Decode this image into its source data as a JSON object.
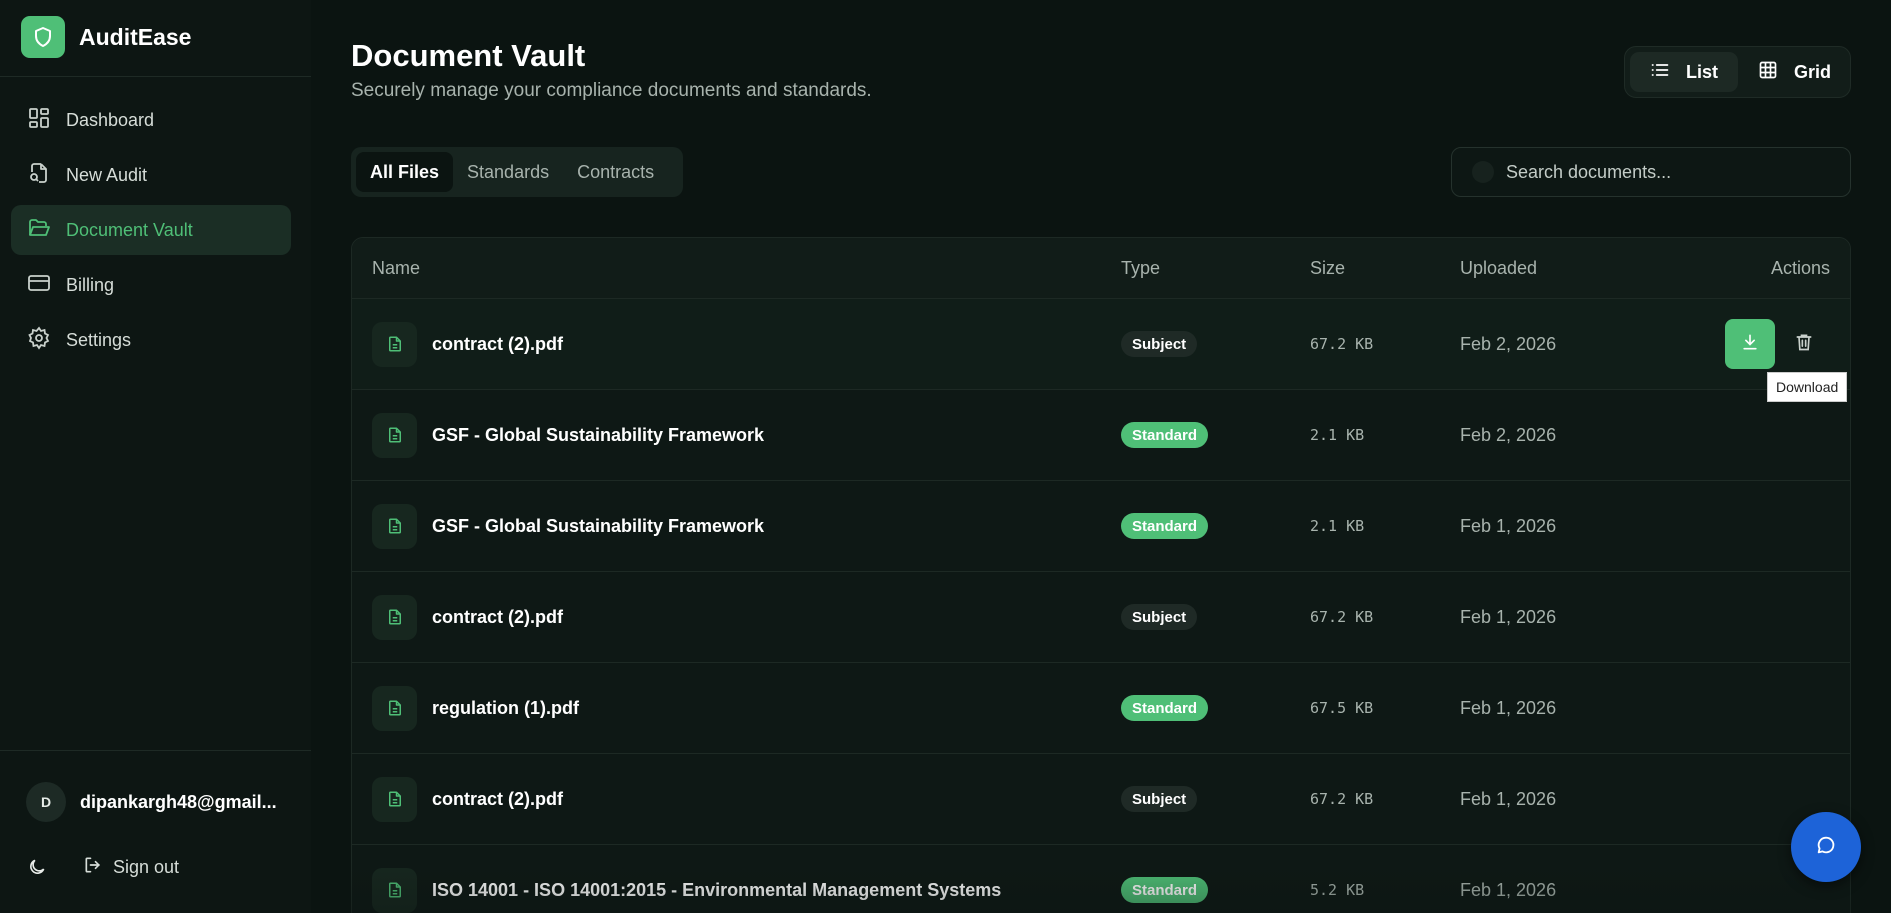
{
  "app": {
    "name": "AuditEase"
  },
  "sidebar": {
    "items": [
      {
        "label": "Dashboard",
        "icon": "dashboard-icon",
        "active": false
      },
      {
        "label": "New Audit",
        "icon": "file-search-icon",
        "active": false
      },
      {
        "label": "Document Vault",
        "icon": "folder-open-icon",
        "active": true
      },
      {
        "label": "Billing",
        "icon": "credit-card-icon",
        "active": false
      },
      {
        "label": "Settings",
        "icon": "gear-icon",
        "active": false
      }
    ],
    "user": {
      "initial": "D",
      "email": "dipankargh48@gmail..."
    },
    "sign_out": "Sign out"
  },
  "header": {
    "title": "Document Vault",
    "subtitle": "Securely manage your compliance documents and standards."
  },
  "view_toggle": {
    "list": "List",
    "grid": "Grid",
    "selected": "List"
  },
  "tabs": [
    {
      "label": "All Files",
      "active": true
    },
    {
      "label": "Standards",
      "active": false
    },
    {
      "label": "Contracts",
      "active": false
    }
  ],
  "search": {
    "placeholder": "Search documents...",
    "value": ""
  },
  "table": {
    "columns": {
      "name": "Name",
      "type": "Type",
      "size": "Size",
      "uploaded": "Uploaded",
      "actions": "Actions"
    },
    "rows": [
      {
        "name": "contract (2).pdf",
        "type": "Subject",
        "size": "67.2 KB",
        "uploaded": "Feb 2, 2026"
      },
      {
        "name": "GSF - Global Sustainability Framework",
        "type": "Standard",
        "size": "2.1 KB",
        "uploaded": "Feb 2, 2026"
      },
      {
        "name": "GSF - Global Sustainability Framework",
        "type": "Standard",
        "size": "2.1 KB",
        "uploaded": "Feb 1, 2026"
      },
      {
        "name": "contract (2).pdf",
        "type": "Subject",
        "size": "67.2 KB",
        "uploaded": "Feb 1, 2026"
      },
      {
        "name": "regulation (1).pdf",
        "type": "Standard",
        "size": "67.5 KB",
        "uploaded": "Feb 1, 2026"
      },
      {
        "name": "contract (2).pdf",
        "type": "Subject",
        "size": "67.2 KB",
        "uploaded": "Feb 1, 2026"
      },
      {
        "name": "ISO 14001 - ISO 14001:2015 - Environmental Management Systems",
        "type": "Standard",
        "size": "5.2 KB",
        "uploaded": "Feb 1, 2026"
      }
    ]
  },
  "tooltip": {
    "text": "Download"
  },
  "colors": {
    "accent": "#4fbf77",
    "background": "#0b1411",
    "chat": "#1d63d8"
  }
}
